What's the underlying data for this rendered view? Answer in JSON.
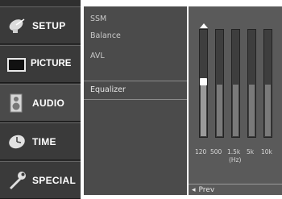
{
  "menu": {
    "items": [
      {
        "label": "SETUP",
        "icon": "satellite-dish-icon"
      },
      {
        "label": "PICTURE",
        "icon": "tv-screen-icon"
      },
      {
        "label": "AUDIO",
        "icon": "speaker-icon"
      },
      {
        "label": "TIME",
        "icon": "clock-icon"
      },
      {
        "label": "SPECIAL",
        "icon": "wrench-icon"
      }
    ],
    "active": "AUDIO"
  },
  "submenu": {
    "items": [
      "SSM",
      "Balance",
      "AVL",
      "Equalizer"
    ],
    "selected": "Equalizer"
  },
  "equalizer": {
    "bands": [
      {
        "label": "120",
        "level": 0.5
      },
      {
        "label": "500",
        "level": 0.5
      },
      {
        "label": "1.5k",
        "level": 0.5
      },
      {
        "label": "5k",
        "level": 0.5
      },
      {
        "label": "10k",
        "level": 0.5
      }
    ],
    "unit": "(Hz)",
    "prev_label": "Prev"
  },
  "colors": {
    "menu_bg": "#3a3a3a",
    "submenu_bg": "#4b4b4b",
    "panel_bg": "#5a5a5a",
    "text": "#ffffff"
  }
}
